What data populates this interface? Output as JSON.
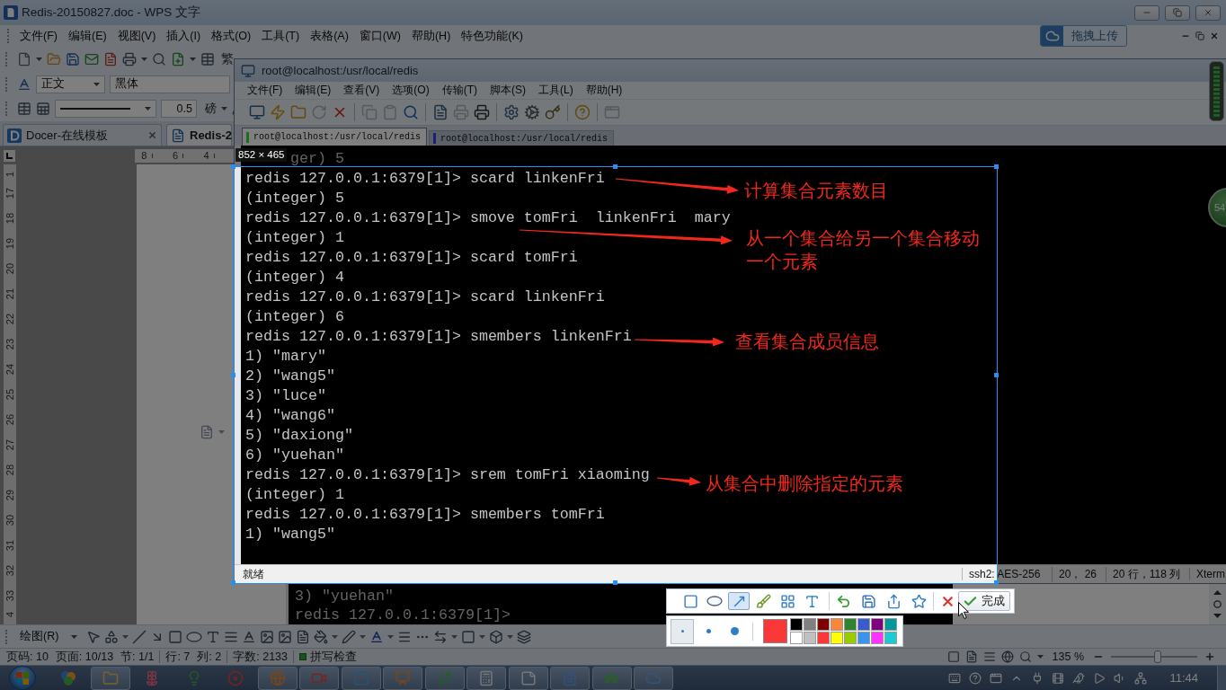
{
  "wps": {
    "title": "Redis-20150827.doc - WPS 文字",
    "menu": [
      "文件(F)",
      "编辑(E)",
      "视图(V)",
      "插入(I)",
      "格式(O)",
      "工具(T)",
      "表格(A)",
      "窗口(W)",
      "帮助(H)",
      "特色功能(K)"
    ],
    "upload_button": "拖拽上传",
    "toolbar_label": "繁",
    "style_box": "正文",
    "font_box": "黑体",
    "line_width": {
      "value": "0.5",
      "unit": "磅"
    },
    "doc_tabs": [
      {
        "label": "Docer-在线模板",
        "selected": false
      },
      {
        "label": "Redis-2",
        "selected": true
      }
    ],
    "horizontal_ruler": [
      "8",
      "6",
      "4"
    ],
    "vertical_ruler": [
      "1",
      "17",
      "18",
      "19",
      "20",
      "21",
      "22",
      "23",
      "24",
      "25",
      "26",
      "27",
      "28",
      "29",
      "30",
      "31",
      "32",
      "33",
      "4"
    ],
    "embedded_screenshot": [
      "3) \"yuehan\"",
      "redis 127.0.0.1:6379[1]>"
    ],
    "drawing_toolbar": "绘图(R)",
    "status_groups": [
      [
        "页码: 10",
        "页面: 10/13",
        "节: 1/1"
      ],
      [
        "行: 7",
        "列: 2"
      ],
      [
        "字数: 2133"
      ]
    ],
    "spell_check": "拼写检查",
    "zoom": {
      "value": "135 %",
      "level": 0.54
    }
  },
  "terminal_window": {
    "title": "root@localhost:/usr/local/redis",
    "menu": [
      "文件(F)",
      "编辑(E)",
      "查看(V)",
      "选项(O)",
      "传输(T)",
      "脚本(S)",
      "工具(L)",
      "帮助(H)"
    ],
    "toolbar": [
      {
        "disabled": false
      },
      {
        "disabled": false
      },
      {
        "disabled": false
      },
      {
        "disabled": true
      },
      {
        "disabled": false
      },
      {
        "disabled": true
      },
      {
        "disabled": true
      },
      {
        "disabled": false
      },
      {
        "disabled": false
      },
      {
        "disabled": true
      },
      {
        "disabled": false
      },
      {
        "disabled": false
      },
      {
        "disabled": false
      },
      {
        "disabled": false
      },
      {
        "disabled": false
      },
      {
        "disabled": true
      }
    ],
    "tabs": [
      {
        "label": "root@localhost:/usr/local/redis",
        "selected": true,
        "color": "#1f6b26"
      },
      {
        "label": "root@localhost:/usr/local/redis",
        "selected": false,
        "color": "#1a2278"
      }
    ],
    "partial_line": "ger) 5",
    "lines": [
      "redis 127.0.0.1:6379[1]> scard linkenFri",
      "(integer) 5",
      "redis 127.0.0.1:6379[1]> smove tomFri  linkenFri  mary",
      "(integer) 1",
      "redis 127.0.0.1:6379[1]> scard tomFri",
      "(integer) 4",
      "redis 127.0.0.1:6379[1]> scard linkenFri",
      "(integer) 6",
      "redis 127.0.0.1:6379[1]> smembers linkenFri",
      "1) \"mary\"",
      "2) \"wang5\"",
      "3) \"luce\"",
      "4) \"wang6\"",
      "5) \"daxiong\"",
      "6) \"yuehan\"",
      "redis 127.0.0.1:6379[1]> srem tomFri xiaoming",
      "(integer) 1",
      "redis 127.0.0.1:6379[1]> smembers tomFri",
      "1) \"wang5\""
    ],
    "status": {
      "text": "就绪",
      "cells": [
        "ssh2: AES-256",
        "20， 26",
        "20 行，118 列",
        "Xterm"
      ]
    }
  },
  "floating_ball": "54",
  "capture": {
    "size_label": "852 × 465",
    "annotations": [
      "计算集合元素数目",
      "从一个集合给另一个集合移动一个元素",
      "查看集合成员信息",
      "从集合中删除指定的元素"
    ],
    "tools": [
      {
        "selected": false
      },
      {
        "selected": false
      },
      {
        "selected": true
      },
      {
        "selected": false
      },
      {
        "selected": false
      },
      {
        "selected": false
      }
    ],
    "done_button": "完成",
    "pen_sizes": [
      {
        "selected": true
      },
      {
        "selected": false
      },
      {
        "selected": false
      }
    ],
    "current_swatch": {
      "color": "#fb3838"
    },
    "swatches": [
      {
        "color": "#000000"
      },
      {
        "color": "#808080"
      },
      {
        "color": "#800000"
      },
      {
        "color": "#f7883a"
      },
      {
        "color": "#308430"
      },
      {
        "color": "#385ad3"
      },
      {
        "color": "#800080"
      },
      {
        "color": "#009999"
      },
      {
        "color": "#ffffff"
      },
      {
        "color": "#c0c0c0"
      },
      {
        "color": "#fb3838"
      },
      {
        "color": "#ffff00"
      },
      {
        "color": "#99cc00"
      },
      {
        "color": "#3895ed"
      },
      {
        "color": "#ff33ff"
      },
      {
        "color": "#1ccbd4"
      }
    ]
  },
  "taskbar": {
    "apps": [
      {
        "running": false
      },
      {
        "running": true
      },
      {
        "running": false
      },
      {
        "running": false
      },
      {
        "running": false
      },
      {
        "running": true
      },
      {
        "running": true
      },
      {
        "running": true
      },
      {
        "running": true
      },
      {
        "running": true
      },
      {
        "running": true
      },
      {
        "running": true
      },
      {
        "running": true
      },
      {
        "running": true
      },
      {
        "running": true
      }
    ],
    "clock": "11:44"
  }
}
